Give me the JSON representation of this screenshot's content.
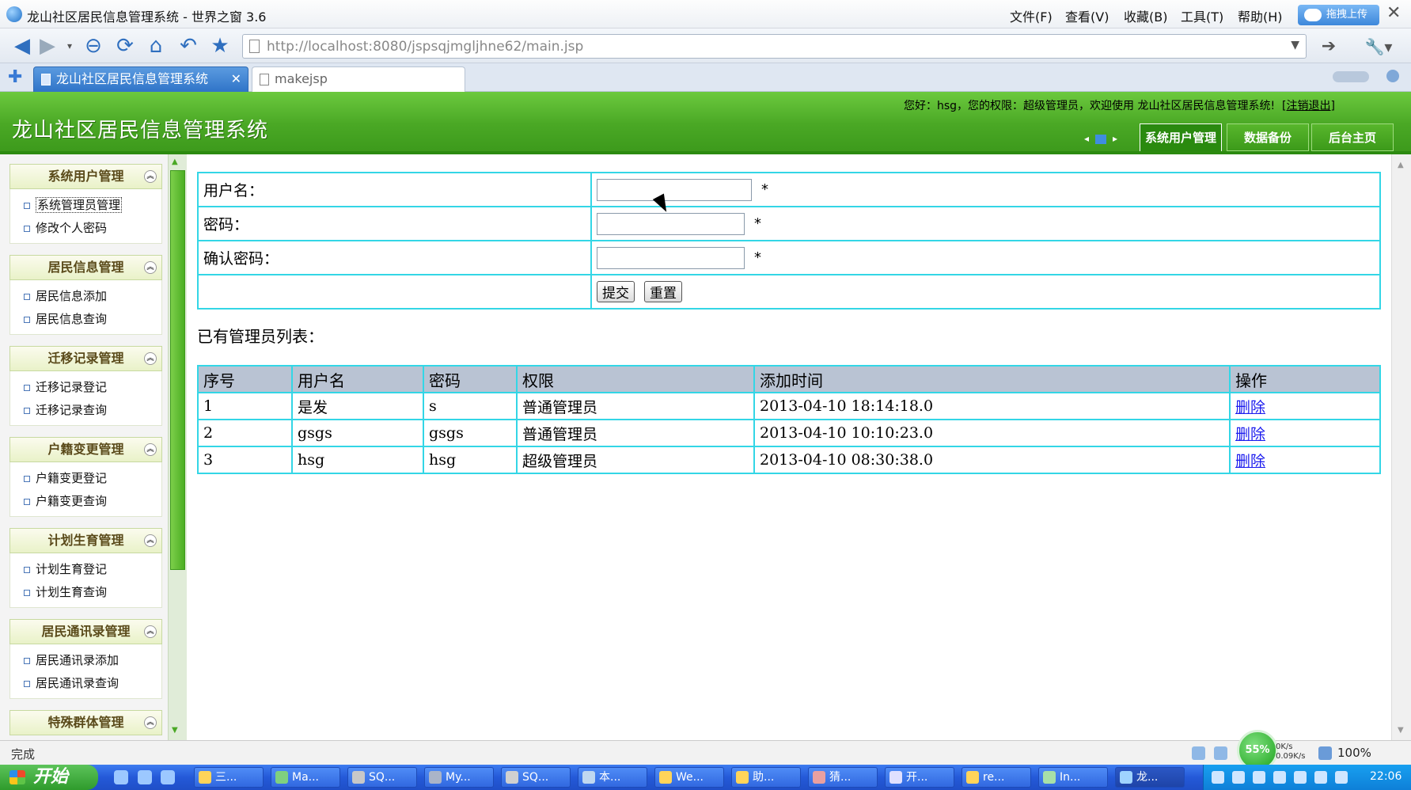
{
  "browser": {
    "title": "龙山社区居民信息管理系统 - 世界之窗 3.6",
    "menu": [
      "文件(F)",
      "查看(V)",
      "收藏(B)",
      "工具(T)",
      "帮助(H)"
    ],
    "upload_label": "拖拽上传",
    "url": "http://localhost:8080/jspsqjmgljhne62/main.jsp",
    "tabs": [
      {
        "label": "龙山社区居民信息管理系统"
      },
      {
        "label": "makejsp"
      }
    ]
  },
  "header": {
    "system_title": "龙山社区居民信息管理系统",
    "welcome": "您好：hsg，您的权限：超级管理员，欢迎使用 龙山社区居民信息管理系统!",
    "logout": "[注销退出]",
    "nav": [
      "系统用户管理",
      "数据备份",
      "后台主页"
    ]
  },
  "sidebar": {
    "groups": [
      {
        "title": "系统用户管理",
        "items": [
          "系统管理员管理",
          "修改个人密码"
        ]
      },
      {
        "title": "居民信息管理",
        "items": [
          "居民信息添加",
          "居民信息查询"
        ]
      },
      {
        "title": "迁移记录管理",
        "items": [
          "迁移记录登记",
          "迁移记录查询"
        ]
      },
      {
        "title": "户籍变更管理",
        "items": [
          "户籍变更登记",
          "户籍变更查询"
        ]
      },
      {
        "title": "计划生育管理",
        "items": [
          "计划生育登记",
          "计划生育查询"
        ]
      },
      {
        "title": "居民通讯录管理",
        "items": [
          "居民通讯录添加",
          "居民通讯录查询"
        ]
      },
      {
        "title": "特殊群体管理",
        "items": []
      }
    ]
  },
  "form": {
    "username_label": "用户名：",
    "password_label": "密码：",
    "confirm_label": "确认密码：",
    "required_mark": "*",
    "submit_label": "提交",
    "reset_label": "重置"
  },
  "admin_list": {
    "title": "已有管理员列表：",
    "columns": [
      "序号",
      "用户名",
      "密码",
      "权限",
      "添加时间",
      "操作"
    ],
    "rows": [
      {
        "no": "1",
        "username": "是发",
        "password": "s",
        "role": "普通管理员",
        "added": "2013-04-10 18:14:18.0",
        "action": "删除"
      },
      {
        "no": "2",
        "username": "gsgs",
        "password": "gsgs",
        "role": "普通管理员",
        "added": "2013-04-10 10:10:23.0",
        "action": "删除"
      },
      {
        "no": "3",
        "username": "hsg",
        "password": "hsg",
        "role": "超级管理员",
        "added": "2013-04-10 08:30:38.0",
        "action": "删除"
      }
    ]
  },
  "statusbar": {
    "status": "完成",
    "zoom": "100%",
    "gauge": "55%",
    "up_speed": "0K/s",
    "down_speed": "0.09K/s"
  },
  "taskbar": {
    "start_label": "开始",
    "items": [
      "三...",
      "Ma...",
      "SQ...",
      "My...",
      "SQ...",
      "本...",
      "We...",
      "助...",
      "猜...",
      "开...",
      "re...",
      "In...",
      "龙..."
    ],
    "clock": "22:06"
  },
  "colors": {
    "header_green": "#4aa825",
    "table_border": "#33d6e6",
    "table_header": "#b9c3d3",
    "link": "#1a1aee"
  }
}
